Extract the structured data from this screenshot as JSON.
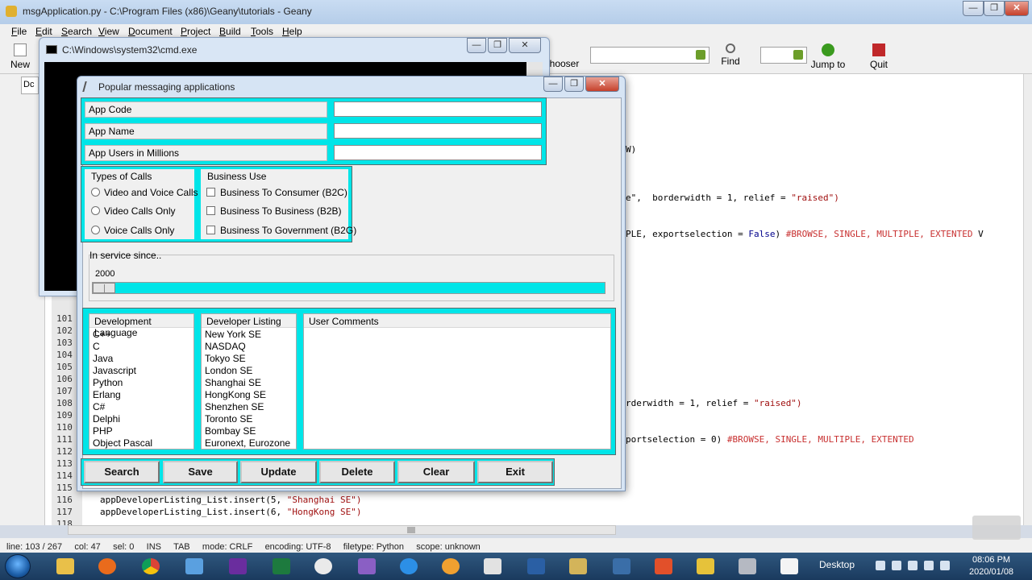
{
  "geany": {
    "title": "msgApplication.py - C:\\Program Files (x86)\\Geany\\tutorials - Geany",
    "menu": [
      "File",
      "Edit",
      "Search",
      "View",
      "Document",
      "Project",
      "Build",
      "Tools",
      "Help"
    ],
    "toolbar": {
      "new_label": "New",
      "chooser_label": "hooser",
      "find_label": "Find",
      "jump_label": "Jump to",
      "quit_label": "Quit"
    },
    "left_tab_label": "Dc",
    "gutter_numbers": [
      "101",
      "102",
      "103",
      "104",
      "105",
      "106",
      "107",
      "108",
      "109",
      "110",
      "111",
      "112",
      "113",
      "114",
      "115",
      "116",
      "117",
      "118"
    ],
    "code_fragments": {
      "w": "W)",
      "relief_line_a": "e\",  borderwidth = 1, relief = ",
      "relief_val_a": "\"raised\")",
      "export_line_a": "PLE, exportselection = ",
      "export_false": "False",
      "export_close_a": ")",
      "export_comment_a": "#BROWSE, SINGLE, MULTIPLE, EXTENTED",
      "export_trail_a": "V",
      "relief_line_b": "rderwidth = 1, relief = ",
      "relief_val_b": "\"raised\")",
      "export_line_b": "portselection = 0) ",
      "export_comment_b": "#BROWSE, SINGLE, MULTIPLE, EXTENTED",
      "line117_a": "appDeveloperListing_List.insert(5, ",
      "line117_b": "\"Shanghai SE\")",
      "line118_a": "appDeveloperListing_List.insert(6, ",
      "line118_b": "\"HongKong SE\")"
    },
    "statusbar": "line: 103 / 267     col: 47     sel: 0     INS     TAB     mode: CRLF     encoding: UTF-8     filetype: Python     scope: unknown"
  },
  "cmd": {
    "title": "C:\\Windows\\system32\\cmd.exe"
  },
  "app": {
    "title": "Popular messaging applications",
    "fields": [
      {
        "label": "App Code",
        "value": ""
      },
      {
        "label": "App Name",
        "value": ""
      },
      {
        "label": "App Users in Millions",
        "value": ""
      }
    ],
    "calls_group": {
      "title": "Types of Calls",
      "options": [
        "Video and Voice Calls",
        "Video Calls Only",
        "Voice Calls Only"
      ]
    },
    "business_group": {
      "title": "Business Use",
      "options": [
        "Business To Consumer (B2C)",
        "Business To Business (B2B)",
        "Business To Government (B2G)"
      ]
    },
    "scale": {
      "label": "In service since..",
      "value": "2000",
      "fraction": 0.0
    },
    "languages": {
      "header": "Development Language",
      "items": [
        "C++",
        "C",
        "Java",
        "Javascript",
        "Python",
        "Erlang",
        "C#",
        "Delphi",
        "PHP",
        "Object Pascal"
      ]
    },
    "developers": {
      "header": "Developer Listing",
      "items": [
        "New York SE",
        "NASDAQ",
        "Tokyo SE",
        "London SE",
        "Shanghai SE",
        "HongKong SE",
        "Shenzhen SE",
        "Toronto SE",
        "Bombay SE",
        "Euronext, Eurozone"
      ]
    },
    "comments": {
      "header": "User Comments",
      "value": ""
    },
    "buttons": [
      "Search",
      "Save",
      "Update",
      "Delete",
      "Clear",
      "Exit"
    ]
  },
  "taskbar": {
    "desktop_label": "Desktop",
    "time": "08:06 PM",
    "date": "2020/01/08",
    "apps": [
      "explorer",
      "firefox",
      "chrome",
      "network",
      "visual-studio",
      "excel",
      "app-7",
      "ie",
      "media-player",
      "paint",
      "powershell",
      "tool-11",
      "tool-12",
      "sublime",
      "geany",
      "sql-server",
      "document"
    ]
  },
  "colors": {
    "accent_cyan": "#00e5e8",
    "string_red": "#a01010"
  }
}
